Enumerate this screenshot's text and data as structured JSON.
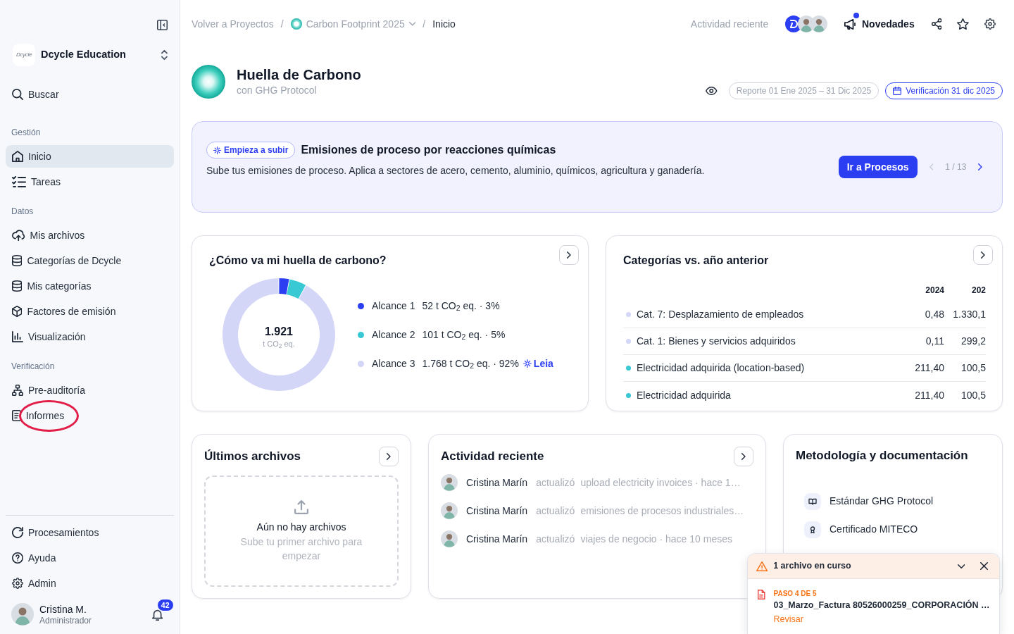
{
  "sidebar": {
    "workspace": {
      "logo_text": "Dcycle",
      "name": "Dcycle Education"
    },
    "search": "Buscar",
    "sections": [
      {
        "title": "Gestión",
        "items": [
          {
            "label": "Inicio",
            "selected": true,
            "highlighted": false
          },
          {
            "label": "Tareas",
            "selected": false,
            "highlighted": false
          }
        ]
      },
      {
        "title": "Datos",
        "items": [
          {
            "label": "Mis archivos",
            "selected": false,
            "highlighted": false
          },
          {
            "label": "Categorías de Dcycle",
            "selected": false,
            "highlighted": false
          },
          {
            "label": "Mis categorías",
            "selected": false,
            "highlighted": false
          },
          {
            "label": "Factores de emisión",
            "selected": false,
            "highlighted": false
          },
          {
            "label": "Visualización",
            "selected": false,
            "highlighted": false
          }
        ]
      },
      {
        "title": "Verificación",
        "items": [
          {
            "label": "Pre-auditoría",
            "selected": false,
            "highlighted": false
          },
          {
            "label": "Informes",
            "selected": false,
            "highlighted": true
          }
        ]
      }
    ],
    "footer_items": [
      {
        "label": "Procesamientos",
        "selected": false
      },
      {
        "label": "Ayuda",
        "selected": false
      },
      {
        "label": "Admin",
        "selected": false
      }
    ],
    "user": {
      "name": "Cristina M.",
      "role": "Administrador",
      "notifications": "42"
    }
  },
  "topbar": {
    "breadcrumb": [
      {
        "kind": "link",
        "label": "Volver a Proyectos"
      },
      {
        "kind": "separator",
        "label": "/"
      },
      {
        "kind": "project",
        "label": "Carbon Footprint 2025"
      },
      {
        "kind": "separator",
        "label": "/"
      },
      {
        "kind": "current",
        "label": "Inicio"
      }
    ],
    "recent_activity": "Actividad reciente",
    "news": {
      "label": "Novedades",
      "unread": true
    }
  },
  "header": {
    "title": "Huella de Carbono",
    "subtitle": "con GHG Protocol",
    "period": "Reporte 01 Ene 2025 – 31 Dic 2025",
    "verification": "Verificación 31 dic 2025"
  },
  "banner": {
    "tag": "Empieza a subir",
    "title": "Emisiones de proceso por reacciones químicas",
    "text": "Sube tus emisiones de proceso. Aplica a sectores de acero, cemento, aluminio, químicos, agricultura y ganadería.",
    "button": "Ir a Procesos",
    "pager": "1 / 13",
    "prev_disabled": true
  },
  "footprint": {
    "title": "¿Cómo va mi huella de carbono?",
    "total": "1.921",
    "unit": "t CO$_{2}$ eq.",
    "chart_data": {
      "type": "donut",
      "categories": [
        "Alcance 1",
        "Alcance 2",
        "Alcance 3"
      ],
      "values": [
        3,
        5,
        92
      ]
    },
    "legend": [
      {
        "value": "52 t CO$_{2}$ eq. · 3%",
        "color": "#2b3ef2"
      },
      {
        "value": "101 t CO$_{2}$ eq. · 5%",
        "color": "#38c9d4"
      },
      {
        "value": "1.768 t CO$_{2}$ eq. · 92%",
        "color": "#d3d6f7",
        "link": "Leia"
      }
    ]
  },
  "categories": {
    "title": "Categorías vs. año anterior",
    "columns": [
      "2024",
      "202"
    ],
    "rows": [
      {
        "name": "Cat. 7: Desplazamiento de empleados",
        "color": "#d3d6f7",
        "values": [
          "0,48",
          "1.330,1"
        ]
      },
      {
        "name": "Cat. 1: Bienes y servicios adquiridos",
        "color": "#d3d6f7",
        "values": [
          "0,11",
          "299,2"
        ]
      },
      {
        "name": "Electricidad adquirida (location-based)",
        "color": "#38c9d4",
        "values": [
          "211,40",
          "100,5"
        ]
      },
      {
        "name": "Electricidad adquirida",
        "color": "#38c9d4",
        "values": [
          "211,40",
          "100,5"
        ]
      }
    ]
  },
  "files": {
    "title": "Últimos archivos",
    "empty_title": "Aún no hay archivos",
    "empty_text": "Sube tu primer archivo para empezar"
  },
  "activity": {
    "title": "Actividad reciente",
    "items": [
      {
        "user": "Cristina Marín",
        "action": "actualizó",
        "detail": "upload electricity invoices · hace 1…"
      },
      {
        "user": "Cristina Marín",
        "action": "actualizó",
        "detail": "emisiones de procesos industriales…"
      },
      {
        "user": "Cristina Marín",
        "action": "actualizó",
        "detail": "viajes de negocio · hace 10 meses"
      }
    ]
  },
  "docs": {
    "title": "Metodología y documentación",
    "items": [
      {
        "label": "Estándar GHG Protocol"
      },
      {
        "label": "Certificado MITECO"
      }
    ]
  },
  "upload_toast": {
    "title": "1 archivo en curso",
    "step": "PASO 4 DE 5",
    "file": "03_Marzo_Factura 80526000259_CORPORACIÓN …",
    "action": "Revisar"
  }
}
